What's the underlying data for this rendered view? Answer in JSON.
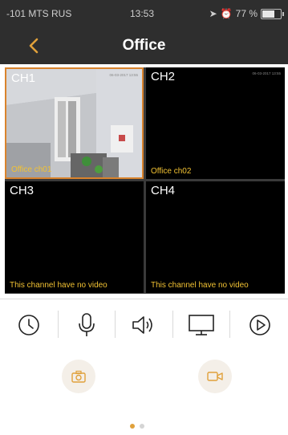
{
  "status_bar": {
    "carrier": "-101 MTS RUS",
    "time": "13:53",
    "battery": "77 %",
    "battery_level": 0.77
  },
  "header": {
    "title": "Office"
  },
  "channels": [
    {
      "label": "CH1",
      "name": "Office ch01",
      "stamp": "06-03-2017 13:55",
      "selected": true
    },
    {
      "label": "CH2",
      "name": "Office ch02",
      "stamp": "06-03-2017 13:55",
      "selected": false
    },
    {
      "label": "CH3",
      "name": "This channel have no video",
      "selected": false
    },
    {
      "label": "CH4",
      "name": "This channel have no video",
      "selected": false
    }
  ],
  "toolbar": {
    "icons": [
      "clock-icon",
      "microphone-icon",
      "speaker-icon",
      "monitor-icon",
      "play-icon"
    ]
  },
  "actions": {
    "icons": [
      "camera-icon",
      "video-camera-icon"
    ]
  },
  "pager": {
    "pages": 2,
    "current": 1
  },
  "colors": {
    "accent": "#e0a13b",
    "selected_border": "#d9832c",
    "channel_name": "#f2c233",
    "header_bg": "#2e2e2e"
  }
}
